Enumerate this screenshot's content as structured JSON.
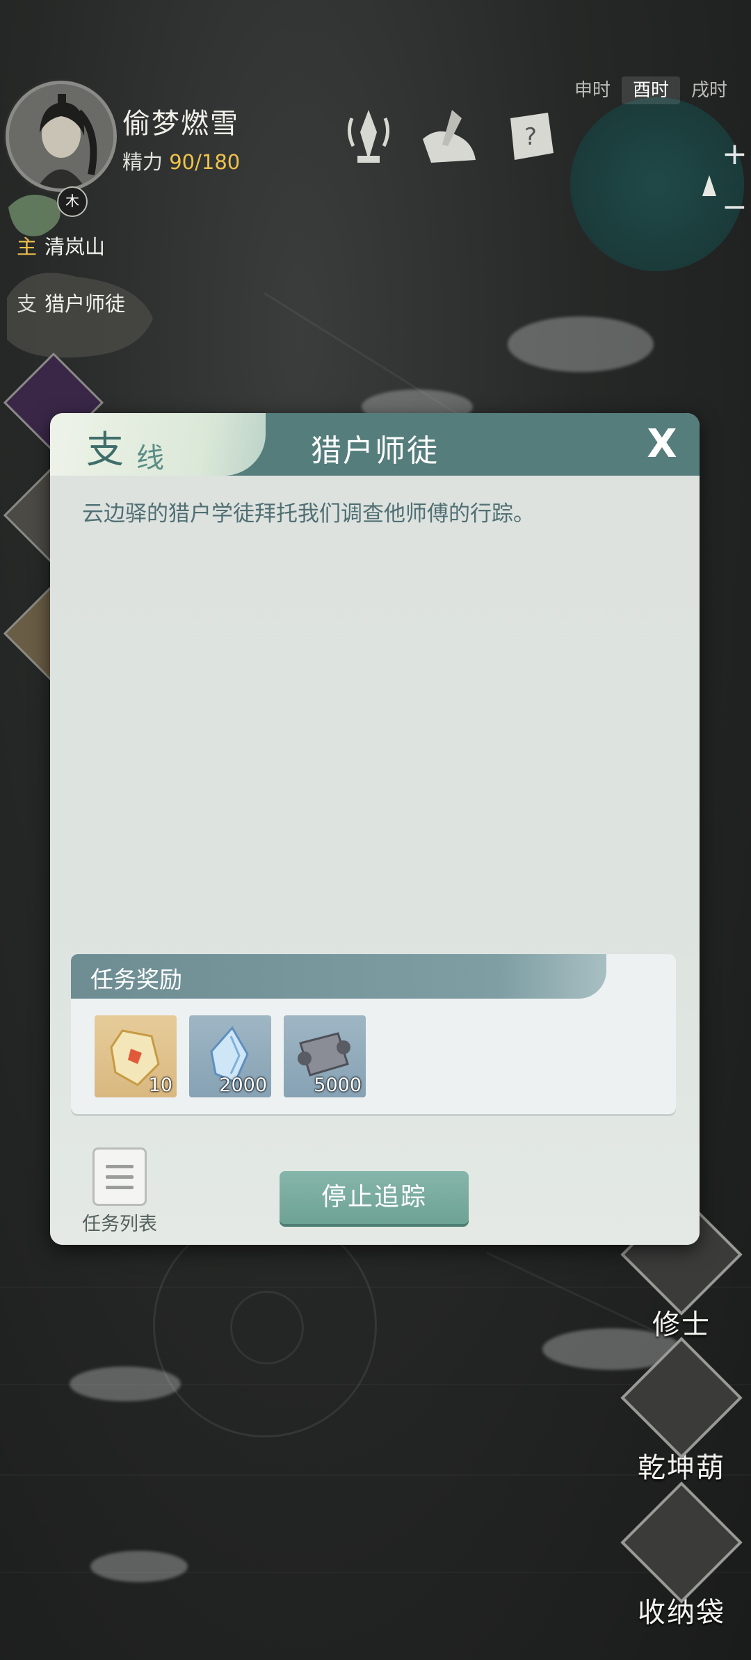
{
  "player": {
    "name": "偷梦燃雪",
    "stamina_label": "精力",
    "stamina_value": "90/180",
    "element_badge": "木"
  },
  "quest_tracker": {
    "main": {
      "tag": "主",
      "text": "清岚山"
    },
    "side": {
      "tag": "支",
      "text": "猎户师徒"
    }
  },
  "time_bar": [
    "申时",
    "酉时",
    "戌时"
  ],
  "minimap": {
    "zoom_in": "+",
    "zoom_out": "−"
  },
  "side_menu": [
    {
      "label": "修士"
    },
    {
      "label": "乾坤葫"
    },
    {
      "label": "收纳袋"
    }
  ],
  "dialog": {
    "tab_main": "支",
    "tab_sub": "线",
    "title": "猎户师徒",
    "close": "X",
    "description": "云边驿的猎户学徒拜托我们调查他师傅的行踪。",
    "reward_header": "任务奖励",
    "rewards": [
      {
        "icon": "gold-crystal-icon",
        "qty": "10"
      },
      {
        "icon": "blue-crystal-icon",
        "qty": "2000"
      },
      {
        "icon": "scroll-icon",
        "qty": "5000"
      }
    ],
    "task_list_label": "任务列表",
    "stop_tracking_label": "停止追踪"
  }
}
